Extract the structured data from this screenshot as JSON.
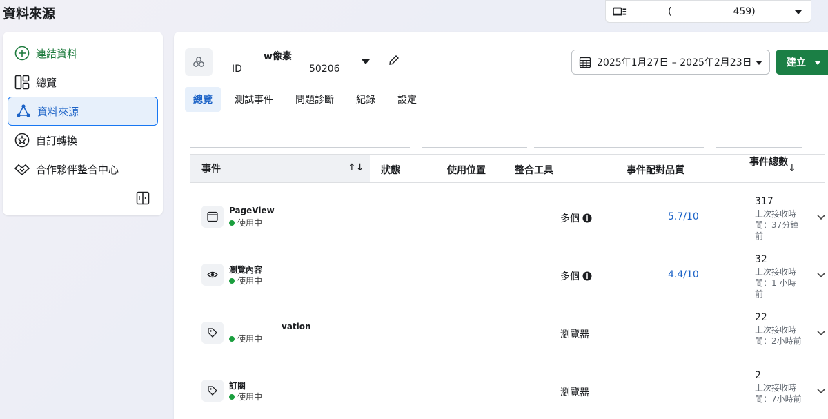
{
  "page": {
    "title": "資料來源"
  },
  "account": {
    "text": "(                    459)"
  },
  "sidebar": {
    "items": [
      {
        "label": "連結資料",
        "icon": "plus-circle-icon"
      },
      {
        "label": "總覽",
        "icon": "layout-icon"
      },
      {
        "label": "資料來源",
        "icon": "data-sources-icon"
      },
      {
        "label": "自訂轉換",
        "icon": "star-badge-icon"
      },
      {
        "label": "合作夥伴整合中心",
        "icon": "handshake-icon"
      }
    ]
  },
  "pixel": {
    "name": "w像素",
    "id_label": "ID",
    "id_value": "50206"
  },
  "toolbar": {
    "date_range": "2025年1月27日 – 2025年2月23日",
    "create_label": "建立"
  },
  "tabs": [
    {
      "label": "總覽"
    },
    {
      "label": "測試事件"
    },
    {
      "label": "問題診斷"
    },
    {
      "label": "紀錄"
    },
    {
      "label": "設定"
    }
  ],
  "table": {
    "headers": {
      "event": "事件",
      "sort": "↑↓",
      "status": "狀態",
      "usage": "使用位置",
      "tools": "整合工具",
      "quality": "事件配對品質",
      "total": "事件總數",
      "total_sort": "↓"
    },
    "rows": [
      {
        "name": "PageView",
        "status": "使用中",
        "icon": "browser-window-icon",
        "tool": "多個",
        "quality": "5.7/10",
        "count": "317",
        "last": "上次接收時間：37分鐘前"
      },
      {
        "name": "瀏覽內容",
        "status": "使用中",
        "icon": "eye-icon",
        "tool": "多個",
        "quality": "4.4/10",
        "count": "32",
        "last": "上次接收時間：1 小時前"
      },
      {
        "name": "vation",
        "status": "使用中",
        "icon": "tag-icon",
        "tool": "瀏覽器",
        "quality": "",
        "count": "22",
        "last": "上次接收時間：2小時前"
      },
      {
        "name": "訂閱",
        "status": "使用中",
        "icon": "tag-icon",
        "tool": "瀏覽器",
        "quality": "",
        "count": "2",
        "last": "上次接收時間：7小時前"
      }
    ]
  }
}
